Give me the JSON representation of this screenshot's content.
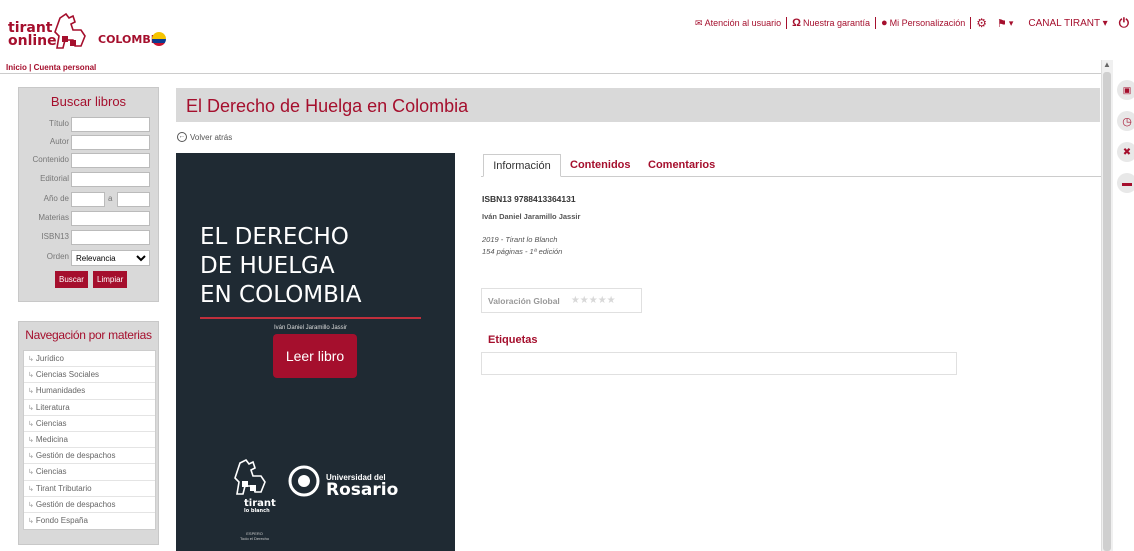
{
  "brand": {
    "logo_line1": "tirant",
    "logo_line2": "online",
    "country": "COLOMBIA",
    "flag_colors": [
      "#f5c400",
      "#0b3a8f",
      "#c8102e"
    ]
  },
  "topnav": {
    "atencion": "Atención al usuario",
    "garantia": "Nuestra garantía",
    "personalizacion": "Mi Personalización",
    "canal": "CANAL TIRANT"
  },
  "breadcrumb": "Inicio | Cuenta personal",
  "search": {
    "title": "Buscar libros",
    "fields": {
      "titulo": "Título",
      "autor": "Autor",
      "contenido": "Contenido",
      "editorial": "Editorial",
      "anio": "Año de",
      "anio_a": "a",
      "materias": "Materias",
      "isbn": "ISBN13",
      "orden": "Orden"
    },
    "orden_value": "Relevancia",
    "buscar": "Buscar",
    "limpiar": "Limpiar"
  },
  "nav": {
    "title": "Navegación por materias",
    "items": [
      "Jurídico",
      "Ciencias Sociales",
      "Humanidades",
      "Literatura",
      "Ciencias",
      "Medicina",
      "Gestión de despachos",
      "Ciencias",
      "Tirant Tributario",
      "Gestión de despachos",
      "Fondo España"
    ]
  },
  "book": {
    "page_title": "El Derecho de Huelga en Colombia",
    "back": "Volver atrás",
    "cover_title": [
      "EL DERECHO",
      "DE HUELGA",
      "EN COLOMBIA"
    ],
    "cover_author": "Iván Daniel Jaramillo Jassir",
    "read_button": "Leer libro",
    "cover_publisher": "tirant",
    "cover_publisher_sub": "lo blanch",
    "cover_publisher_tag1": "ESPERO",
    "cover_publisher_tag2": "Todo el Derecho",
    "cover_uni_small": "Universidad del",
    "cover_uni_big": "Rosario",
    "tabs": [
      "Información",
      "Contenidos",
      "Comentarios"
    ],
    "isbn": "ISBN13 9788413364131",
    "author": "Iván Daniel Jaramillo Jassir",
    "pub_line1": "2019 - Tirant lo Blanch",
    "pub_line2": "154 páginas - 1ª edición",
    "rating_label": "Valoración Global",
    "rating_stars": "★★★★★",
    "tags_title": "Etiquetas"
  },
  "accent_color": "#a50f2d"
}
